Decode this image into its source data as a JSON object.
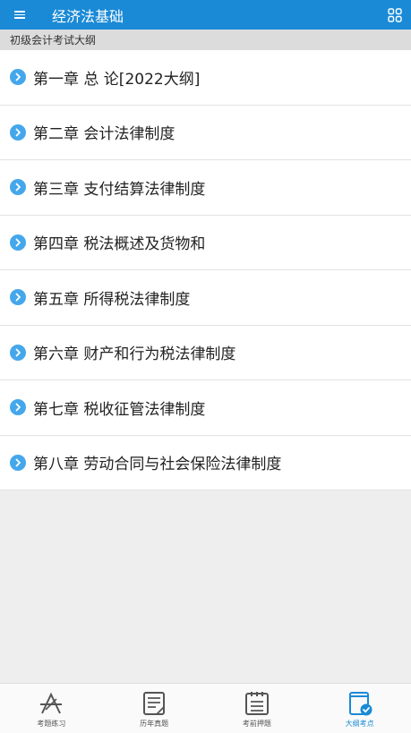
{
  "header": {
    "title": "经济法基础",
    "menu_icon": "hamburger-menu-icon",
    "grid_icon": "grid-icon",
    "color": "#1a8ad6"
  },
  "subheader": {
    "label": "初级会计考试大纲"
  },
  "chapters": [
    {
      "label": "第一章 总 论[2022大纲]"
    },
    {
      "label": "第二章 会计法律制度"
    },
    {
      "label": "第三章 支付结算法律制度"
    },
    {
      "label": "第四章 税法概述及货物和"
    },
    {
      "label": "第五章 所得税法律制度"
    },
    {
      "label": "第六章 财产和行为税法律制度"
    },
    {
      "label": "第七章 税收征管法律制度"
    },
    {
      "label": "第八章 劳动合同与社会保险法律制度"
    }
  ],
  "tabs": [
    {
      "label": "考题练习",
      "icon": "exam-practice-icon",
      "active": false
    },
    {
      "label": "历年真题",
      "icon": "past-papers-icon",
      "active": false
    },
    {
      "label": "考前押题",
      "icon": "pre-exam-icon",
      "active": false
    },
    {
      "label": "大纲考点",
      "icon": "syllabus-icon",
      "active": true
    }
  ]
}
